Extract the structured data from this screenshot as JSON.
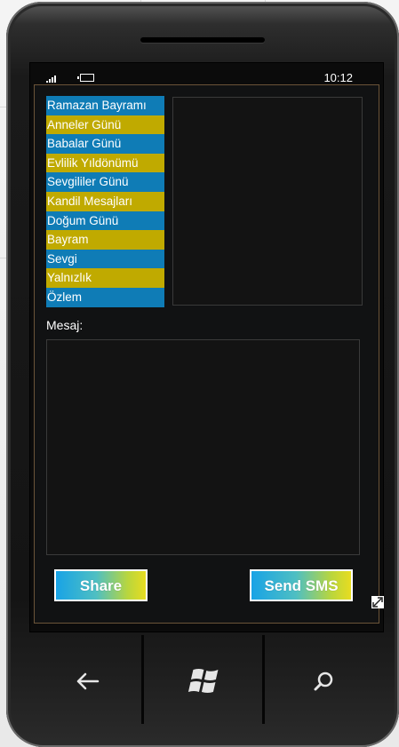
{
  "status_bar": {
    "time": "10:12",
    "signal_icon": "signal-icon",
    "battery_icon": "battery-icon"
  },
  "categories": {
    "items": [
      {
        "label": "Ramazan Bayramı",
        "color": "#0f7cb6"
      },
      {
        "label": "Anneler Günü",
        "color": "#c0aa00"
      },
      {
        "label": "Babalar Günü",
        "color": "#0f7cb6"
      },
      {
        "label": "Evlilik Yıldönümü",
        "color": "#c0aa00"
      },
      {
        "label": "Sevgililer Günü",
        "color": "#0f7cb6"
      },
      {
        "label": "Kandil Mesajları",
        "color": "#c0aa00"
      },
      {
        "label": "Doğum Günü",
        "color": "#0f7cb6"
      },
      {
        "label": "Bayram",
        "color": "#c0aa00"
      },
      {
        "label": "Sevgi",
        "color": "#0f7cb6"
      },
      {
        "label": "Yalnızlık",
        "color": "#c0aa00"
      },
      {
        "label": "Özlem",
        "color": "#0f7cb6"
      }
    ]
  },
  "message": {
    "label": "Mesaj:",
    "value": ""
  },
  "buttons": {
    "share_label": "Share",
    "send_label": "Send SMS"
  },
  "nav": {
    "back_icon": "back-arrow-icon",
    "start_icon": "windows-logo-icon",
    "search_icon": "search-icon"
  },
  "colors": {
    "blue_item": "#0f7cb6",
    "yellow_item": "#c0aa00",
    "button_gradient_start": "#18a3e6",
    "button_gradient_end": "#e8dc20"
  }
}
